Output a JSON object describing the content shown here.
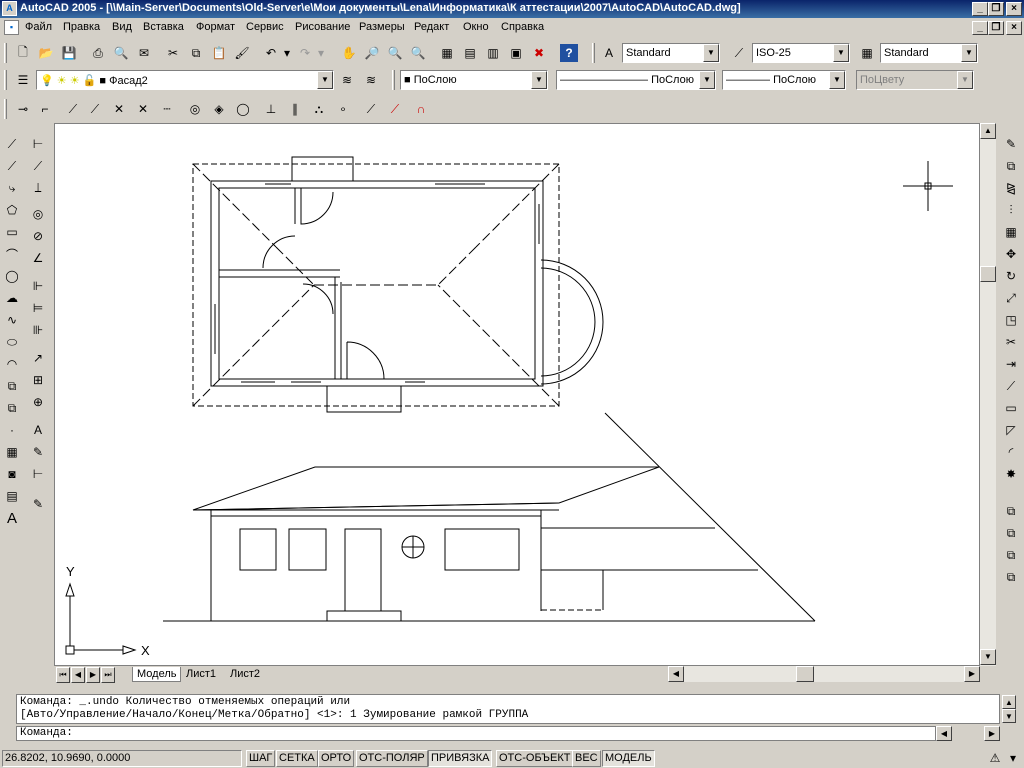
{
  "title": "AutoCAD 2005 - [\\\\Main-Server\\Documents\\Old-Server\\e\\Мои документы\\Lena\\Информатика\\К аттестации\\2007\\AutoCAD\\AutoCAD.dwg]",
  "menu": [
    "Файл",
    "Правка",
    "Вид",
    "Вставка",
    "Формат",
    "Сервис",
    "Рисование",
    "Размеры",
    "Редакт",
    "Окно",
    "Справка"
  ],
  "styles": {
    "text_style": "Standard",
    "dim_style": "ISO-25",
    "table_style": "Standard"
  },
  "layers": {
    "current": "Фасад2",
    "color": "ПоСлою",
    "linetype": "ПоСлою",
    "lineweight": "ПоСлою",
    "plotstyle": "ПоЦвету"
  },
  "tabs": [
    "Модель",
    "Лист1",
    "Лист2"
  ],
  "axis": {
    "y": "Y",
    "x": "X"
  },
  "command": {
    "line1": "Команда: _.undo Количество отменяемых операций или",
    "line2": "[Авто/Управление/Начало/Конец/Метка/Обратно] <1>: 1 Зумирование рамкой ГРУППА",
    "prompt": "Команда:"
  },
  "status": {
    "coords": "26.8202, 10.9690, 0.0000",
    "toggles": [
      "ШАГ",
      "СЕТКА",
      "ОРТО",
      "ОТС-ПОЛЯР",
      "ПРИВЯЗКА",
      "ОТС-ОБЪЕКТ",
      "ВЕС",
      "МОДЕЛЬ"
    ],
    "active": [
      "ПРИВЯЗКА",
      "МОДЕЛЬ"
    ]
  }
}
